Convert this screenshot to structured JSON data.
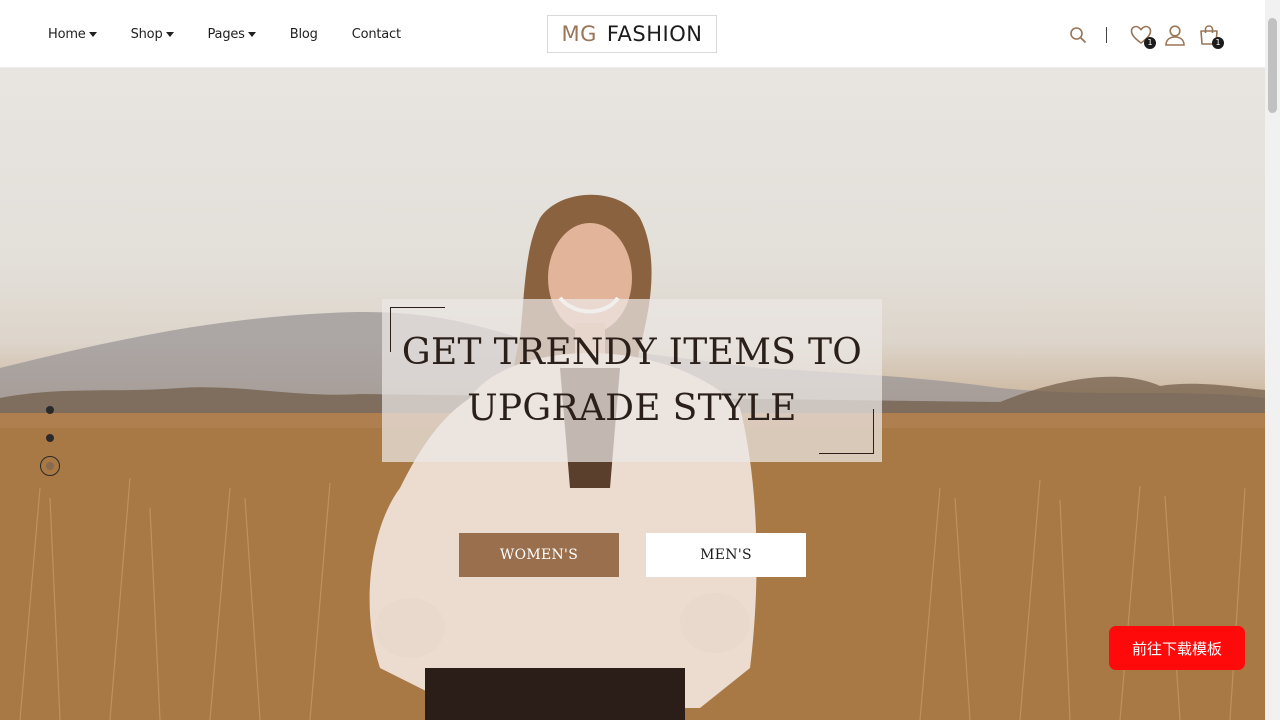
{
  "header": {
    "nav": [
      {
        "label": "Home",
        "has_dropdown": true
      },
      {
        "label": "Shop",
        "has_dropdown": true
      },
      {
        "label": "Pages",
        "has_dropdown": true
      },
      {
        "label": "Blog",
        "has_dropdown": false
      },
      {
        "label": "Contact",
        "has_dropdown": false
      }
    ],
    "logo": {
      "part1": "MG",
      "part2": "FASHION"
    },
    "icons": {
      "search": "search-icon",
      "wishlist": "heart-icon",
      "account": "user-icon",
      "cart": "shopping-bag-icon"
    },
    "wishlist_count": "1",
    "cart_count": "1"
  },
  "hero": {
    "headline_line1": "GET TRENDY ITEMS TO",
    "headline_line2": "UPGRADE STYLE",
    "buttons": {
      "women": "WOMEN'S",
      "men": "MEN'S"
    },
    "slides": {
      "count": 3,
      "active_index": 2
    }
  },
  "floating": {
    "download_label": "前往下载模板"
  },
  "colors": {
    "accent": "#9a6f4d",
    "logo_accent": "#9a7556",
    "text_dark": "#2b1f19",
    "download_bg": "#ff0a0a"
  }
}
